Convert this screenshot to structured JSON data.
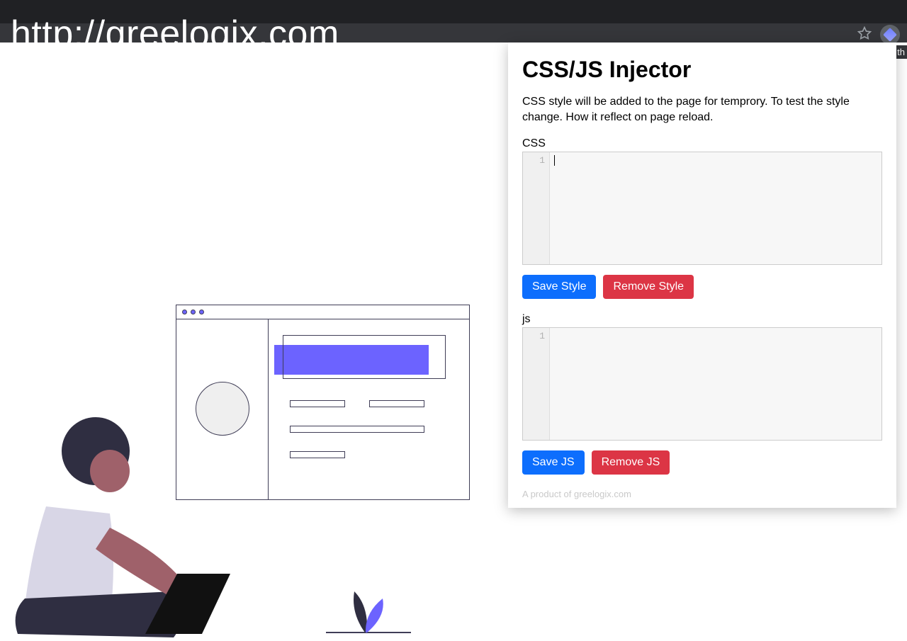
{
  "browser": {
    "url_display": "http://greelogix.com",
    "corner_fragment": "th"
  },
  "popup": {
    "title": "CSS/JS Injector",
    "description": "CSS style will be added to the page for temprory. To test the style change. How it reflect on page reload.",
    "css_label": "CSS",
    "css_line_number": "1",
    "css_value": "",
    "save_style_label": "Save Style",
    "remove_style_label": "Remove Style",
    "js_label": "js",
    "js_line_number": "1",
    "js_value": "",
    "save_js_label": "Save JS",
    "remove_js_label": "Remove JS",
    "credit": "A product of greelogix.com"
  },
  "icons": {
    "star": "star-icon",
    "extension": "injector-extension-icon"
  }
}
